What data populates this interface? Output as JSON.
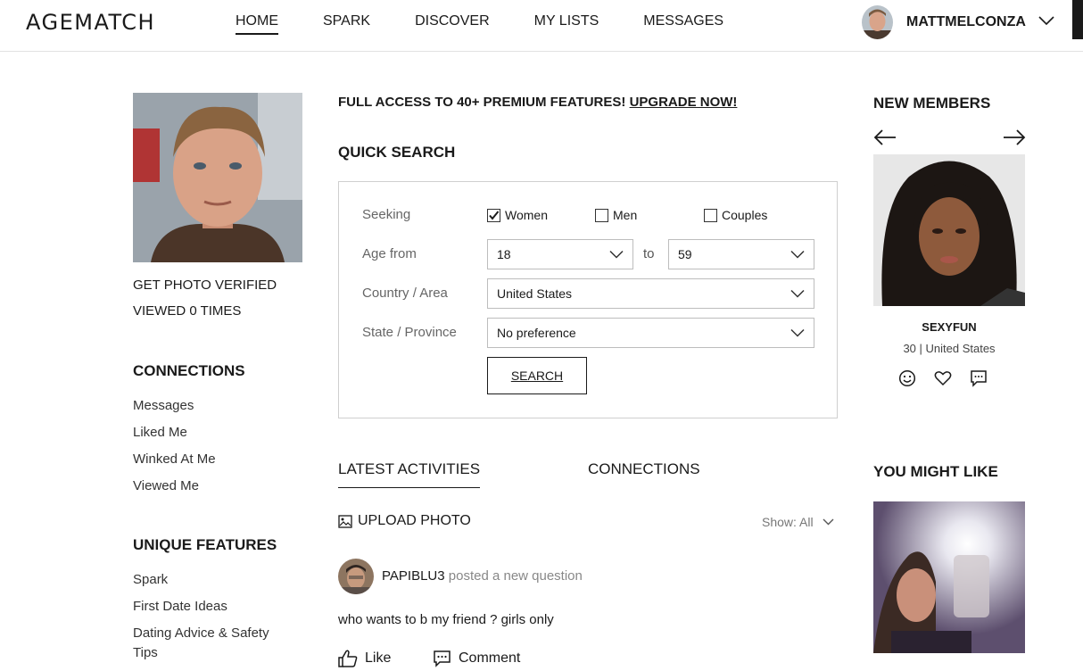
{
  "header": {
    "logo": "AGEMATCH",
    "nav": [
      "HOME",
      "SPARK",
      "DISCOVER",
      "MY LISTS",
      "MESSAGES"
    ],
    "active_nav": "HOME",
    "username": "MATTMELCONZA"
  },
  "left": {
    "photo_verified": "GET PHOTO VERIFIED",
    "viewed": "VIEWED 0 TIMES",
    "connections_title": "CONNECTIONS",
    "connections": [
      "Messages",
      "Liked Me",
      "Winked At Me",
      "Viewed Me"
    ],
    "features_title": "UNIQUE FEATURES",
    "features": [
      "Spark",
      "First Date Ideas",
      "Dating Advice & Safety",
      "Tips"
    ]
  },
  "promo": {
    "text": "FULL ACCESS TO 40+ PREMIUM FEATURES! ",
    "link": "UPGRADE NOW!"
  },
  "quick_search": {
    "title": "QUICK SEARCH",
    "seeking_label": "Seeking",
    "options": [
      {
        "label": "Women",
        "checked": true
      },
      {
        "label": "Men",
        "checked": false
      },
      {
        "label": "Couples",
        "checked": false
      }
    ],
    "age_label": "Age from",
    "age_from": "18",
    "to_label": "to",
    "age_to": "59",
    "country_label": "Country / Area",
    "country": "United States",
    "state_label": "State / Province",
    "state": "No preference",
    "search_button": "SEARCH"
  },
  "activity": {
    "tabs": [
      "LATEST ACTIVITIES",
      "CONNECTIONS"
    ],
    "upload": "UPLOAD PHOTO",
    "show": "Show: All",
    "post": {
      "user": "PAPIBLU3",
      "action": " posted a new question",
      "text": "who wants to b my friend ? girls only",
      "like": "Like",
      "comment": "Comment"
    }
  },
  "right": {
    "new_members_title": "NEW MEMBERS",
    "member": {
      "name": "SEXYFUN",
      "info": "30 | United States"
    },
    "might_like_title": "YOU MIGHT LIKE"
  }
}
